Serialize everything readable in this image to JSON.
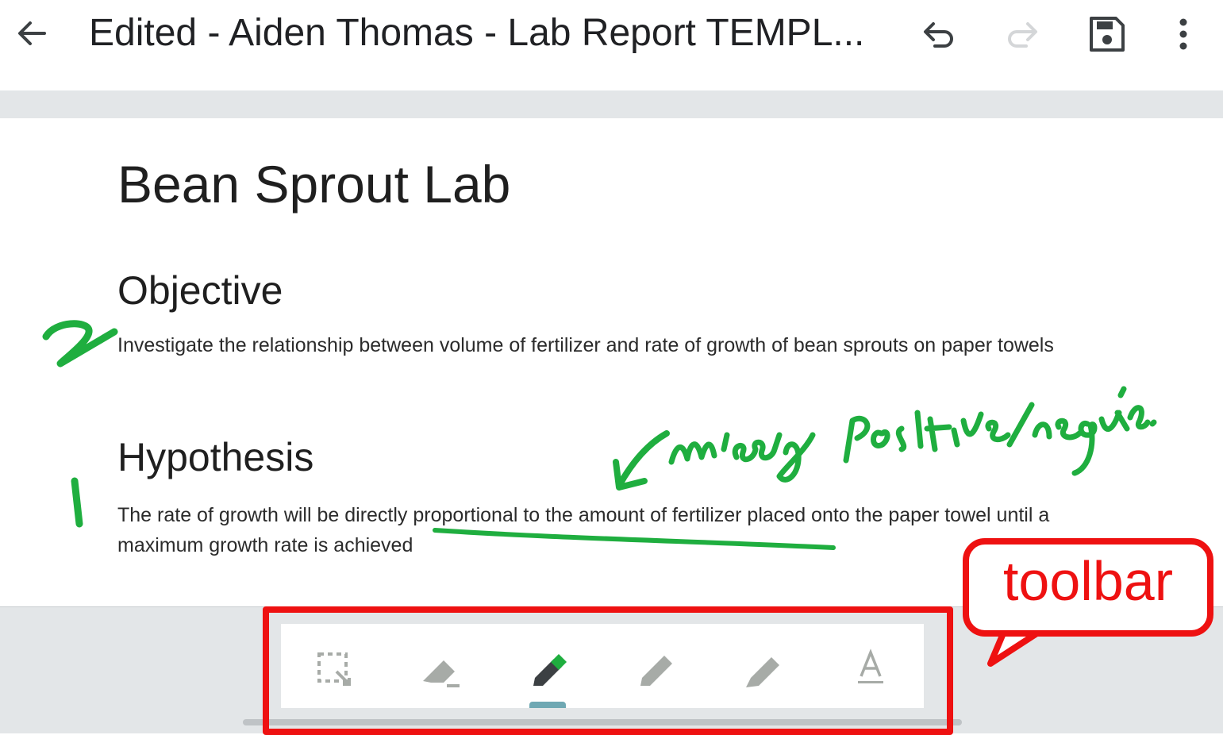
{
  "appbar": {
    "back_icon": "arrow-left-icon",
    "title": "Edited - Aiden Thomas - Lab Report TEMPL...",
    "undo_icon": "undo-icon",
    "redo_icon": "redo-icon",
    "save_icon": "save-icon",
    "more_icon": "more-vert-icon"
  },
  "document": {
    "title": "Bean Sprout Lab",
    "sections": [
      {
        "heading": "Objective",
        "text": "Investigate the relationship between volume of fertilizer and rate of growth of bean sprouts on paper towels"
      },
      {
        "heading": "Hypothesis",
        "text": "The rate of growth will be directly proportional to the amount of fertilizer placed onto the paper towel until a maximum growth rate is achieved"
      }
    ]
  },
  "ink_annotations": {
    "color": "#1fae3f",
    "marks": [
      "2",
      "1",
      "missing positive/negative"
    ]
  },
  "toolbar": {
    "tools": [
      {
        "icon": "lasso-select-icon"
      },
      {
        "icon": "eraser-icon"
      },
      {
        "icon": "pen-icon",
        "color": "#1fae3f",
        "active": true
      },
      {
        "icon": "pencil-icon"
      },
      {
        "icon": "highlighter-icon"
      },
      {
        "icon": "text-tool-icon"
      }
    ]
  },
  "callout": {
    "label": "toolbar",
    "color": "#ee1111"
  }
}
